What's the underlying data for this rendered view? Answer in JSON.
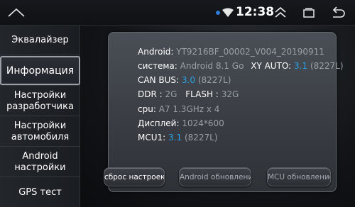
{
  "statusbar": {
    "time": "12:38"
  },
  "sidebar": {
    "items": [
      {
        "label": "Эквалайзер"
      },
      {
        "label": "Информация"
      },
      {
        "label": "Настройки разработчика"
      },
      {
        "label": "Настройки автомобиля"
      },
      {
        "label": "Android настройки"
      },
      {
        "label": "GPS тест"
      }
    ],
    "active_index": 1
  },
  "info": {
    "android_label": "Android:",
    "android_value": "YT9216BF_00002_V004_20190911",
    "system_label": "система:",
    "system_value": "Android 8.1 Go",
    "xyauto_label": "XY AUTO:",
    "xyauto_version": "3.1",
    "xyauto_model": "(8227L)",
    "canbus_label": "CAN BUS:",
    "canbus_version": "3.0",
    "canbus_model": "(8227L)",
    "ddr_label": "DDR :",
    "ddr_value": "2G",
    "flash_label": "FLASH :",
    "flash_value": "32G",
    "cpu_label": "cpu:",
    "cpu_value": "A7 1.3GHz x 4",
    "display_label": "Дисплей:",
    "display_value": "1024*600",
    "mcu_label": "MCU1:",
    "mcu_version": "3.1",
    "mcu_model": "(8227L)"
  },
  "buttons": {
    "reset": "сброс настроек",
    "android_update": "Android обновление",
    "mcu_update": "MCU обновление"
  },
  "colors": {
    "accent": "#2aa0e8",
    "muted_text": "#9aa0a6"
  }
}
